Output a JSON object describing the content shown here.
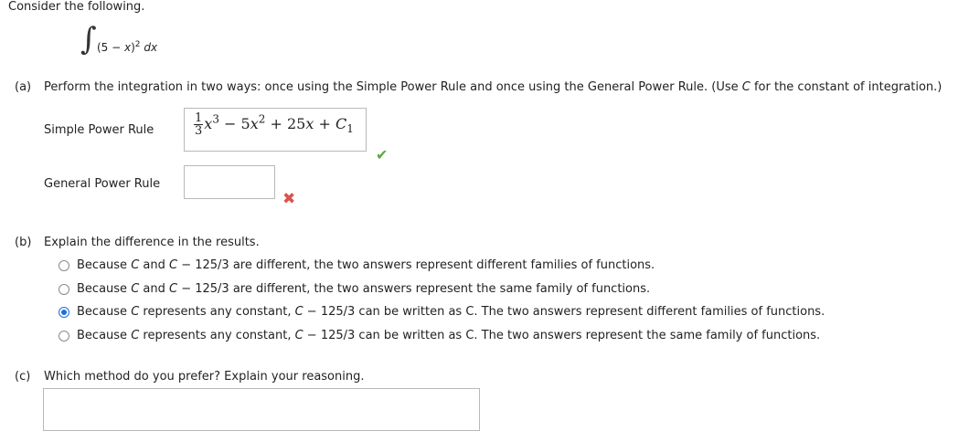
{
  "intro": "Consider the following.",
  "integral": {
    "sign": "∫",
    "expr_open": "(5 − ",
    "var": "x",
    "expr_close": ")",
    "power": "2",
    "dx": "dx"
  },
  "part_a": {
    "letter": "(a)",
    "instruction_pre": "Perform the integration in two ways: once using the Simple Power Rule and once using the General Power Rule. (Use ",
    "instruction_var": "C",
    "instruction_post": " for the constant of integration.)",
    "simple": {
      "label": "Simple Power Rule",
      "answer": {
        "frac_num": "1",
        "frac_den": "3",
        "t1_var": "x",
        "t1_pow": "3",
        "op1": " − 5",
        "t2_var": "x",
        "t2_pow": "2",
        "op2": " + 25",
        "t3_var": "x",
        "op3": " + ",
        "c_var": "C",
        "c_sub": "1"
      },
      "status": "correct",
      "status_icon": "✔"
    },
    "general": {
      "label": "General Power Rule",
      "value": "",
      "status": "incorrect",
      "status_icon": "✖"
    }
  },
  "part_b": {
    "letter": "(b)",
    "question": "Explain the difference in the results.",
    "options": [
      {
        "pre": "Because ",
        "v1": "C",
        "mid": " and ",
        "v2": "C",
        "post": " − 125/3 are different, the two answers represent different families of functions.",
        "selected": false
      },
      {
        "pre": "Because ",
        "v1": "C",
        "mid": " and ",
        "v2": "C",
        "post": " − 125/3 are different, the two answers represent the same family of functions.",
        "selected": false
      },
      {
        "pre": "Because ",
        "v1": "C",
        "mid": " represents any constant, ",
        "v2": "C",
        "post": " − 125/3 can be written as C. The two answers represent different families of functions.",
        "selected": true
      },
      {
        "pre": "Because ",
        "v1": "C",
        "mid": " represents any constant, ",
        "v2": "C",
        "post": " − 125/3 can be written as C. The two answers represent the same family of functions.",
        "selected": false
      }
    ]
  },
  "part_c": {
    "letter": "(c)",
    "question": "Which method do you prefer? Explain your reasoning.",
    "value": ""
  },
  "colors": {
    "correct": "#5fa83c",
    "incorrect": "#d9534f",
    "radio_selected": "#1e6fd9"
  }
}
